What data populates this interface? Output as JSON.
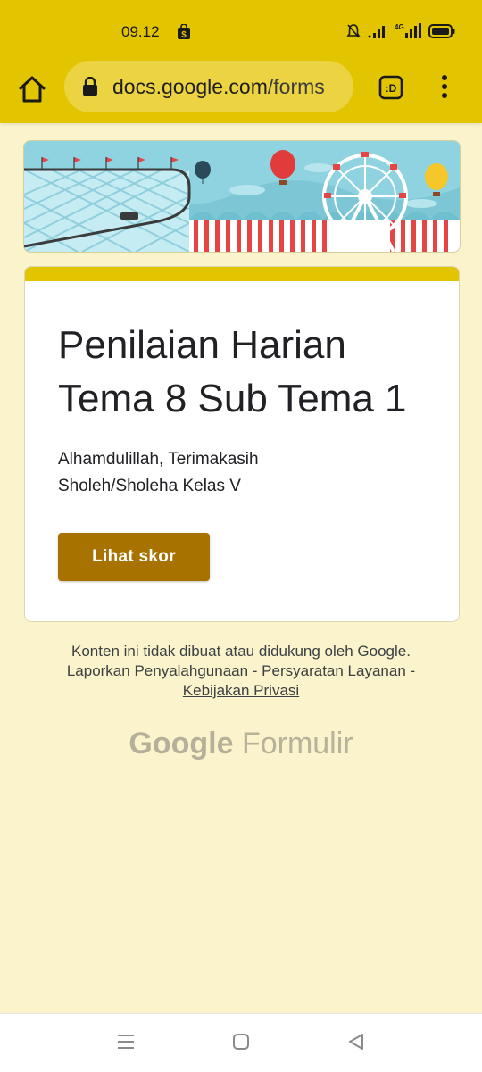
{
  "status_bar": {
    "time": "09.12",
    "icons": [
      "shopping-bag-icon",
      "muted-bell-icon",
      "signal-icon",
      "4g-signal-icon",
      "battery-icon"
    ]
  },
  "browser": {
    "url_domain": "docs.google.com",
    "url_path": "/forms",
    "tabs_label": ":D",
    "icons": [
      "home-icon",
      "lock-icon",
      "tabs-icon",
      "more-vert-icon"
    ]
  },
  "form": {
    "title": "Penilaian Harian Tema 8 Sub Tema 1",
    "description_line1": "Alhamdulillah, Terimakasih",
    "description_line2": "Sholeh/Sholeha Kelas V",
    "button_label": "Lihat skor"
  },
  "footer": {
    "disclaimer": "Konten ini tidak dibuat atau didukung oleh Google.",
    "link_report": "Laporkan Penyalahgunaan",
    "separator": " - ",
    "link_terms": "Persyaratan Layanan",
    "separator_end": " -",
    "link_privacy": "Kebijakan Privasi",
    "brand_google": "Google",
    "brand_product": "Formulir"
  },
  "colors": {
    "accent": "#e3c400",
    "button": "#a87200",
    "background": "#faf3cb"
  },
  "navbar": {
    "icons": [
      "recents-icon",
      "home-nav-icon",
      "back-icon"
    ]
  }
}
